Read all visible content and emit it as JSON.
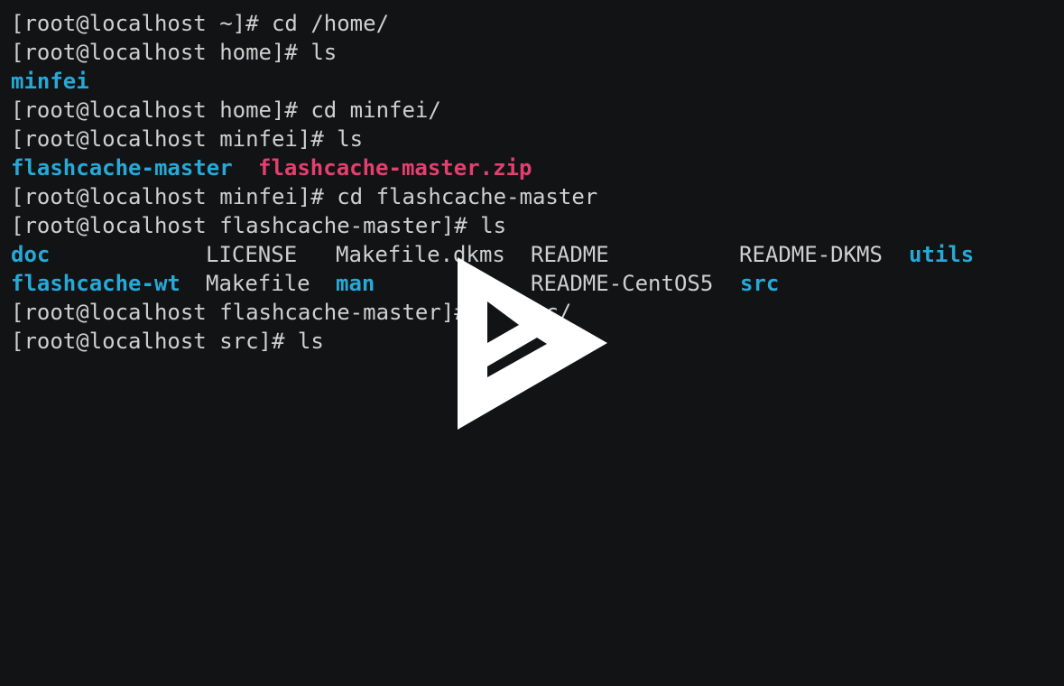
{
  "terminal": {
    "lines": [
      {
        "text": "[root@localhost ~]# cd /home/"
      },
      {
        "text": "[root@localhost home]# ls"
      },
      {
        "dir": "minfei"
      },
      {
        "text": "[root@localhost home]# cd minfei/"
      },
      {
        "text": "[root@localhost minfei]# ls"
      },
      {
        "text": "[root@localhost minfei]# cd flashcache-master"
      },
      {
        "text": "[root@localhost flashcache-master]# ls"
      },
      {
        "text": "[root@localhost flashcache-master]# cd src/"
      },
      {
        "text": "[root@localhost src]# ls"
      }
    ],
    "minfei_listing": {
      "dir": "flashcache-master",
      "zip": "flashcache-master.zip"
    },
    "flashcache_listing": {
      "row1": [
        "doc",
        "LICENSE",
        "Makefile.dkms",
        "README",
        "README-DKMS",
        "utils"
      ],
      "row2": [
        "flashcache-wt",
        "Makefile",
        "man",
        "",
        "README-CentOS5",
        "src"
      ]
    }
  },
  "overlay": {
    "icon": "asciinema-play-icon",
    "color": "#ffffff"
  }
}
